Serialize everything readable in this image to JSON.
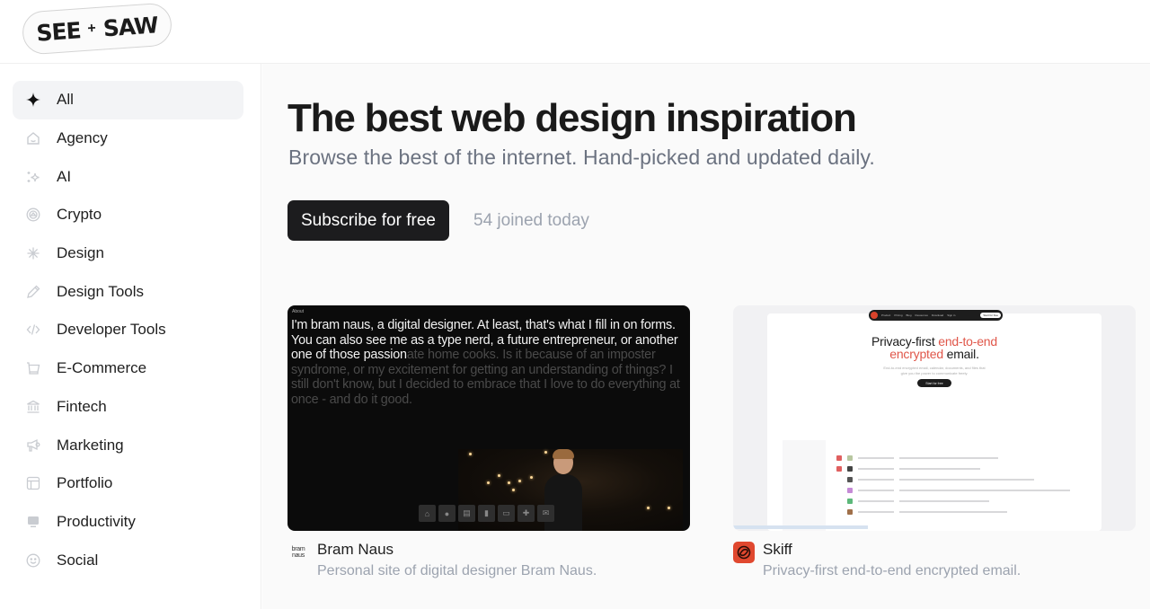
{
  "brand": {
    "logo_left": "SEE",
    "logo_sep": "+",
    "logo_right": "SAW"
  },
  "sidebar": {
    "items": [
      {
        "label": "All",
        "icon": "sparkle-icon",
        "active": true
      },
      {
        "label": "Agency",
        "icon": "house-icon",
        "active": false
      },
      {
        "label": "AI",
        "icon": "ai-sparkles-icon",
        "active": false
      },
      {
        "label": "Crypto",
        "icon": "coin-icon",
        "active": false
      },
      {
        "label": "Design",
        "icon": "asterisk-icon",
        "active": false
      },
      {
        "label": "Design Tools",
        "icon": "pencil-icon",
        "active": false
      },
      {
        "label": "Developer Tools",
        "icon": "code-icon",
        "active": false
      },
      {
        "label": "E-Commerce",
        "icon": "cart-icon",
        "active": false
      },
      {
        "label": "Fintech",
        "icon": "bank-icon",
        "active": false
      },
      {
        "label": "Marketing",
        "icon": "megaphone-icon",
        "active": false
      },
      {
        "label": "Portfolio",
        "icon": "layout-icon",
        "active": false
      },
      {
        "label": "Productivity",
        "icon": "monitor-icon",
        "active": false
      },
      {
        "label": "Social",
        "icon": "smiley-icon",
        "active": false
      }
    ]
  },
  "hero": {
    "title": "The best web design inspiration",
    "subtitle": "Browse the best of the internet. Hand-picked and updated daily.",
    "subscribe_label": "Subscribe for free",
    "joined_text": "54 joined today"
  },
  "cards": [
    {
      "title": "Bram Naus",
      "description": "Personal site of digital designer Bram Naus.",
      "favicon_text_top": "bram",
      "favicon_text_bottom": "naus",
      "thumbnail": {
        "label": "About",
        "text_highlight": "I'm bram naus, a digital designer. At least, that's what I fill in on forms. You can also see me as a type nerd, a future entrepreneur, or another one of those passion",
        "text_dim": "ate home cooks. Is it because of an imposter syndrome, or my excitement for getting an understanding of things? I still don't know, but I decided to embrace that I love to do everything at once - and do it good."
      }
    },
    {
      "title": "Skiff",
      "description": "Privacy-first end-to-end encrypted email.",
      "favicon_color": "#e0482f",
      "thumbnail": {
        "nav_items": [
          "Product",
          "Pricing",
          "Blog",
          "Resources",
          "Download",
          "Sign in"
        ],
        "nav_cta": "Start for free",
        "headline_a": "Privacy-first ",
        "headline_b": "end-to-end",
        "headline_c": "encrypted",
        "headline_d": " email.",
        "subcopy": "End-to-end encrypted email, calendar, documents, and files that give you the power to communicate freely.",
        "cta": "Start for free",
        "accent": "#e0574a"
      }
    }
  ]
}
